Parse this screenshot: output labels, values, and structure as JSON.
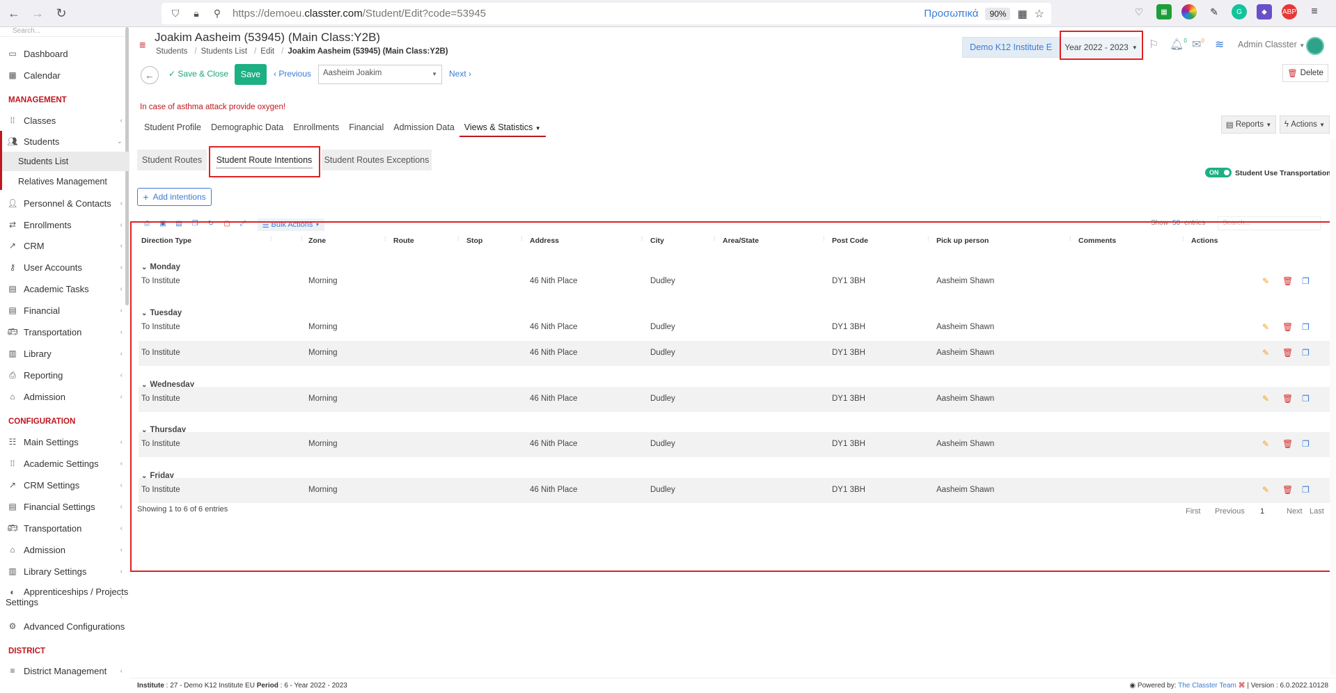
{
  "browser": {
    "url_prefix": "https://demoeu.",
    "url_domain": "classter.com",
    "url_path": "/Student/Edit?code=53945",
    "greek_link": "Προσωπικά",
    "zoom": "90%"
  },
  "sidebar": {
    "search_placeholder": "Search...",
    "dashboard": "Dashboard",
    "calendar": "Calendar",
    "management_label": "MANAGEMENT",
    "classes": "Classes",
    "students": "Students",
    "students_list": "Students List",
    "relatives_management": "Relatives Management",
    "personnel_contacts": "Personnel & Contacts",
    "enrollments": "Enrollments",
    "crm": "CRM",
    "user_accounts": "User Accounts",
    "academic_tasks": "Academic Tasks",
    "financial": "Financial",
    "transportation": "Transportation",
    "library": "Library",
    "reporting": "Reporting",
    "admission": "Admission",
    "configuration_label": "CONFIGURATION",
    "main_settings": "Main Settings",
    "academic_settings": "Academic Settings",
    "crm_settings": "CRM Settings",
    "financial_settings": "Financial Settings",
    "transportation_cfg": "Transportation",
    "admission_cfg": "Admission",
    "library_settings": "Library Settings",
    "apprenticeships_1": "Apprenticeships / Projects",
    "apprenticeships_2": "Settings",
    "advanced_configurations": "Advanced Configurations",
    "district_label": "DISTRICT",
    "district_management": "District Management"
  },
  "header": {
    "title": "Joakim Aasheim (53945) (Main Class:Y2B)",
    "breadcrumb": [
      "Students",
      "Students List",
      "Edit"
    ],
    "breadcrumb_current": "Joakim Aasheim (53945) (Main Class:Y2B)",
    "institute": "Demo K12 Institute E",
    "year": "Year 2022 - 2023",
    "admin_user": "Admin Classter",
    "notif_count": "0",
    "mail_count": "0"
  },
  "toolbar": {
    "save_close": "Save & Close",
    "save": "Save",
    "previous": "Previous",
    "student_selected": "Aasheim Joakim",
    "next": "Next",
    "delete": "Delete"
  },
  "alert": "In case of asthma attack provide oxygen!",
  "tabs": [
    "Student Profile",
    "Demographic Data",
    "Enrollments",
    "Financial",
    "Admission Data",
    "Views & Statistics"
  ],
  "reports_label": "Reports",
  "actions_label": "Actions",
  "subtabs": [
    "Student Routes",
    "Student Route Intentions",
    "Student Routes Exceptions"
  ],
  "toggle": {
    "state": "ON",
    "label": "Student Use Transportation"
  },
  "add_intentions": "Add intentions",
  "table": {
    "bulk_actions": "Bulk Actions",
    "show_label": "Show",
    "show_count": "50",
    "entries_label": "entries",
    "search_placeholder": "Search...",
    "headers": [
      "Direction Type",
      "Zone",
      "Route",
      "Stop",
      "Address",
      "City",
      "Area/State",
      "Post Code",
      "Pick up person",
      "Comments",
      "Actions"
    ],
    "groups": [
      {
        "day": "Monday",
        "rows": [
          {
            "direction": "To Institute",
            "zone": "Morning",
            "address": "46 Nith Place",
            "city": "Dudley",
            "post_code": "DY1 3BH",
            "pickup": "Aasheim Shawn"
          }
        ]
      },
      {
        "day": "Tuesday",
        "rows": [
          {
            "direction": "To Institute",
            "zone": "Morning",
            "address": "46 Nith Place",
            "city": "Dudley",
            "post_code": "DY1 3BH",
            "pickup": "Aasheim Shawn"
          },
          {
            "direction": "To Institute",
            "zone": "Morning",
            "address": "46 Nith Place",
            "city": "Dudley",
            "post_code": "DY1 3BH",
            "pickup": "Aasheim Shawn"
          }
        ]
      },
      {
        "day": "Wednesday",
        "rows": [
          {
            "direction": "To Institute",
            "zone": "Morning",
            "address": "46 Nith Place",
            "city": "Dudley",
            "post_code": "DY1 3BH",
            "pickup": "Aasheim Shawn"
          }
        ]
      },
      {
        "day": "Thursday",
        "rows": [
          {
            "direction": "To Institute",
            "zone": "Morning",
            "address": "46 Nith Place",
            "city": "Dudley",
            "post_code": "DY1 3BH",
            "pickup": "Aasheim Shawn"
          }
        ]
      },
      {
        "day": "Friday",
        "rows": [
          {
            "direction": "To Institute",
            "zone": "Morning",
            "address": "46 Nith Place",
            "city": "Dudley",
            "post_code": "DY1 3BH",
            "pickup": "Aasheim Shawn"
          }
        ]
      }
    ],
    "showing": "Showing 1 to 6 of 6 entries",
    "pager": [
      "First",
      "Previous",
      "1",
      "Next",
      "Last"
    ]
  },
  "footer": {
    "inst_label": "Institute",
    "inst_value": ": 27 - Demo K12 Institute EU",
    "period_label": "Period",
    "period_value": ": 6 - Year 2022 - 2023",
    "powered_by": "Powered by:",
    "team": "The Classter Team",
    "version": "| Version : 6.0.2022.10128"
  },
  "colors": {
    "accent_red": "#c0161d",
    "accent_green": "#1cb083",
    "link_blue": "#3a7bd5",
    "highlight": "#e02020"
  }
}
